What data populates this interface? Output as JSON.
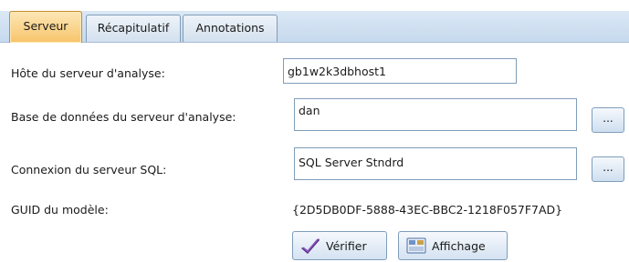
{
  "tabs": [
    {
      "label": "Serveur",
      "active": true
    },
    {
      "label": "Récapitulatif",
      "active": false
    },
    {
      "label": "Annotations",
      "active": false
    }
  ],
  "form": {
    "host_label": "Hôte du serveur d'analyse:",
    "host_value": "gb1w2k3dbhost1",
    "db_label": "Base de données du serveur d'analyse:",
    "db_value": "dan",
    "db_browse_label": "...",
    "sql_label": "Connexion du serveur SQL:",
    "sql_value": "SQL Server Stndrd",
    "sql_browse_label": "...",
    "guid_label": "GUID du modèle:",
    "guid_value": "{2D5DB0DF-5888-43EC-BBC2-1218F057F7AD}"
  },
  "buttons": {
    "verify_label": "Vérifier",
    "verify_icon": "check-icon",
    "display_label": "Affichage",
    "display_icon": "view-icon"
  },
  "colors": {
    "tab_active": "#f7c56a",
    "tabstrip": "#c6d9ee",
    "check_icon": "#5b2a86",
    "border": "#7f9db9"
  }
}
